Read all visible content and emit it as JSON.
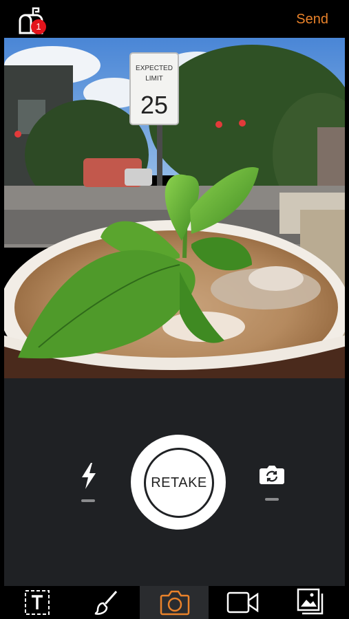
{
  "header": {
    "notification_count": "1",
    "send_label": "Send"
  },
  "camera": {
    "shutter_label": "RETAKE"
  },
  "photo": {
    "sign_line1": "EXPECTED",
    "sign_line2": "LIMIT",
    "sign_number": "25"
  },
  "tabs": [
    {
      "icon": "text-icon",
      "active": false
    },
    {
      "icon": "brush-icon",
      "active": false
    },
    {
      "icon": "camera-icon",
      "active": true
    },
    {
      "icon": "video-icon",
      "active": false
    },
    {
      "icon": "gallery-icon",
      "active": false
    }
  ],
  "colors": {
    "accent": "#e9822a",
    "badge": "#e3141c",
    "panel": "#1f2124"
  }
}
